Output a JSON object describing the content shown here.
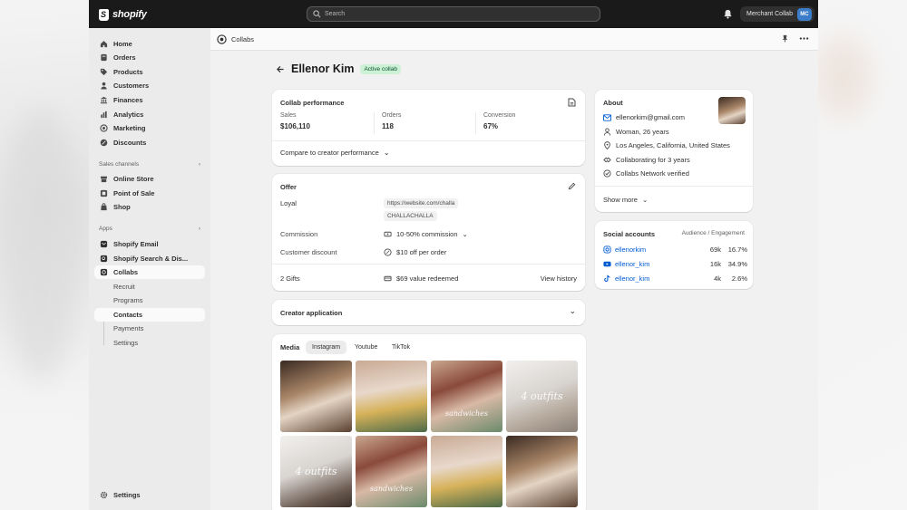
{
  "colors": {
    "topbar": "#1a1a1a",
    "link": "#005bd3",
    "badge_bg": "#cdf1d5",
    "badge_text": "#0c5132",
    "avatar_mc": "#3b7dc9"
  },
  "topbar": {
    "logo_text": "shopify",
    "search_placeholder": "Search",
    "account_name": "Merchant Collab",
    "account_initials": "MC"
  },
  "sidebar": {
    "items": [
      {
        "label": "Home",
        "icon": "home-icon"
      },
      {
        "label": "Orders",
        "icon": "orders-icon"
      },
      {
        "label": "Products",
        "icon": "tag-icon"
      },
      {
        "label": "Customers",
        "icon": "person-icon"
      },
      {
        "label": "Finances",
        "icon": "bank-icon"
      },
      {
        "label": "Analytics",
        "icon": "chart-icon"
      },
      {
        "label": "Marketing",
        "icon": "target-icon"
      },
      {
        "label": "Discounts",
        "icon": "discount-icon"
      }
    ],
    "sales_channels_heading": "Sales channels",
    "channels": [
      {
        "label": "Online Store",
        "icon": "store-icon"
      },
      {
        "label": "Point of Sale",
        "icon": "pos-icon"
      },
      {
        "label": "Shop",
        "icon": "shop-icon"
      }
    ],
    "apps_heading": "Apps",
    "apps": [
      {
        "label": "Shopify Email"
      },
      {
        "label": "Shopify Search & Dis..."
      },
      {
        "label": "Collabs"
      }
    ],
    "collabs_sub": [
      "Recruit",
      "Programs",
      "Contacts",
      "Payments",
      "Settings"
    ],
    "settings_label": "Settings"
  },
  "header": {
    "crumb": "Collabs",
    "title": "Ellenor Kim",
    "status": "Active collab"
  },
  "performance": {
    "title": "Collab performance",
    "metrics": [
      {
        "label": "Sales",
        "value": "$106,110"
      },
      {
        "label": "Orders",
        "value": "118"
      },
      {
        "label": "Conversion",
        "value": "67%"
      }
    ],
    "compare_label": "Compare to creator performance"
  },
  "offer": {
    "title": "Offer",
    "name": "Loyal",
    "url": "https://website.com/challa",
    "code": "CHALLACHALLA",
    "commission_label": "Commission",
    "commission_value": "10-50% commission",
    "discount_label": "Customer discount",
    "discount_value": "$10 off per order",
    "gifts_label": "2 Gifts",
    "gifts_value": "$69 value redeemed",
    "view_history": "View history"
  },
  "creator_application": {
    "title": "Creator application"
  },
  "media": {
    "title": "Media",
    "tabs": [
      "Instagram",
      "Youtube",
      "TikTok"
    ],
    "active_tab": "Instagram",
    "thumbs": [
      {
        "caption": ""
      },
      {
        "caption": ""
      },
      {
        "caption": "sandwiches"
      },
      {
        "caption": "4 outfits"
      },
      {
        "caption": "4 outfits"
      },
      {
        "caption": "sandwiches"
      },
      {
        "caption": ""
      },
      {
        "caption": ""
      }
    ]
  },
  "about": {
    "title": "About",
    "email": "ellenorkim@gmail.com",
    "demographic": "Woman, 26 years",
    "location": "Los Angeles, California, United States",
    "tenure": "Collaborating for 3 years",
    "verified": "Collabs Network verified",
    "show_more": "Show more"
  },
  "social": {
    "title": "Social accounts",
    "header": "Audience / Engagement",
    "accounts": [
      {
        "platform": "instagram-icon",
        "handle": "ellenorkim",
        "audience": "69k",
        "engagement": "16.7%"
      },
      {
        "platform": "youtube-icon",
        "handle": "ellenor_kim",
        "audience": "16k",
        "engagement": "34.9%"
      },
      {
        "platform": "tiktok-icon",
        "handle": "ellenor_kim",
        "audience": "4k",
        "engagement": "2.6%"
      }
    ]
  }
}
